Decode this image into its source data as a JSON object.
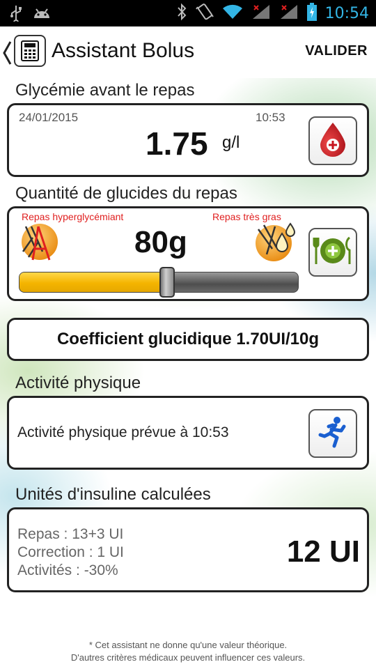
{
  "status_bar": {
    "time": "10:54",
    "icons": [
      "usb-icon",
      "android-icon",
      "bluetooth-icon",
      "vibrate-icon",
      "wifi-icon",
      "signal-icon",
      "signal-icon",
      "battery-charging-icon"
    ]
  },
  "header": {
    "title": "Assistant Bolus",
    "validate_label": "VALIDER",
    "icon": "calculator-icon"
  },
  "glycemia": {
    "section_title": "Glycémie avant le repas",
    "date": "24/01/2015",
    "time": "10:53",
    "value": "1.75",
    "unit": "g/l",
    "button_icon": "blood-drop-plus-icon",
    "accent_color": "#c8141e"
  },
  "carbs": {
    "section_title": "Quantité de glucides du repas",
    "left_label": "Repas hyperglycémiant",
    "right_label": "Repas très gras",
    "value": "80g",
    "slider_fraction": 0.53,
    "button_icon": "plate-plus-icon",
    "slider_color": "#f4b400",
    "label_color": "#e02020"
  },
  "coefficient": {
    "label": "Coefficient glucidique 1.70UI/10g"
  },
  "activity": {
    "section_title": "Activité physique",
    "text": "Activité physique prévue à 10:53",
    "button_icon": "runner-icon"
  },
  "insulin": {
    "section_title": "Unités d'insuline calculées",
    "lines": [
      "Repas : 13+3 UI",
      "Correction : 1 UI",
      "Activités : -30%"
    ],
    "total": "12 UI"
  },
  "footnote": {
    "line1": "* Cet assistant ne donne qu'une valeur théorique.",
    "line2": "D'autres critères médicaux peuvent influencer ces valeurs."
  }
}
